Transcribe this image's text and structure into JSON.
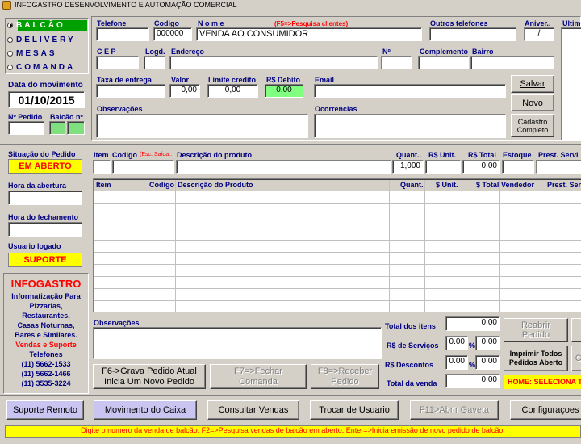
{
  "window": {
    "title": "INFOGASTRO DESENVOLVIMENTO E AUTOMAÇÃO COMERCIAL"
  },
  "modes": {
    "balcao": "BALCÃO",
    "delivery": "DELIVERY",
    "mesas": "MESAS",
    "comanda": "COMANDA",
    "selected": "BALCÃO"
  },
  "movimento": {
    "label": "Data do movimento",
    "date": "01/10/2015"
  },
  "pedido": {
    "label": "Nº Pedido",
    "balcao_label": "Balcão nº",
    "value": "",
    "balcao_value": ""
  },
  "customer": {
    "telefone_label": "Telefone",
    "telefone": "",
    "codigo_label": "Codigo",
    "codigo": "000000",
    "nome_label": "N o m e",
    "nome_hint": "(F5=>Pesquisa clientes)",
    "nome": "VENDA AO CONSUMIDOR",
    "outros_label": "Outros telefones",
    "outros": "",
    "aniver_label": "Aniver..",
    "aniver": "/",
    "ultimo_label": "Ultimo",
    "cep_label": "C E P",
    "cep": "",
    "logd_label": "Logd.",
    "logd": "",
    "endereco_label": "Endereço",
    "endereco": "",
    "numero_label": "Nº",
    "numero": "",
    "complemento_label": "Complemento",
    "complemento": "",
    "bairro_label": "Bairro",
    "bairro": "",
    "taxa_label": "Taxa de entrega",
    "taxa": "",
    "valor_label": "Valor",
    "valor": "0,00",
    "limite_label": "Limite credito",
    "limite": "0,00",
    "debito_label": "R$ Debito",
    "debito": "0,00",
    "email_label": "Email",
    "email": "",
    "obs_label": "Observações",
    "obs": "",
    "ocorrencias_label": "Ocorrencias",
    "ocorrencias": ""
  },
  "actions": {
    "salvar": "Salvar",
    "novo": "Novo",
    "cadastro_1": "Cadastro",
    "cadastro_2": "Completo"
  },
  "status": {
    "situacao_label": "Situação do Pedido",
    "situacao": "EM ABERTO",
    "abertura_label": "Hora da abertura",
    "abertura": "",
    "fechamento_label": "Hora do fechamento",
    "fechamento": "",
    "usuario_label": "Usuario logado",
    "usuario": "SUPORTE"
  },
  "company": {
    "name": "INFOGASTRO",
    "line1": "Informatização Para",
    "line2": "Pizzarias,",
    "line3": "Restaurantes,",
    "line4": "Casas Noturnas,",
    "line5": "Bares e Similares.",
    "line6": "Vendas e Suporte",
    "line7": "Telefones",
    "phone1": "(11) 5662-1533",
    "phone2": "(11) 5662-1466",
    "phone3": "(11) 3535-3224"
  },
  "entry": {
    "item_label": "Item",
    "codigo_label": "Codigo",
    "codigo_hint": "(Esc: Saída..",
    "descricao_label": "Descrição do produto",
    "quant_label": "Quant..",
    "unit_label": "R$ Unit.",
    "total_label": "R$ Total",
    "estoque_label": "Estoque",
    "prest_label": "Prest. Servi",
    "quant": "1,000",
    "unit": "",
    "total": "0,00"
  },
  "grid": {
    "columns": [
      "Item",
      "Codigo",
      "Descrição do Produto",
      "Quant.",
      "$ Unit.",
      "$ Total",
      "Vendedor",
      "Prest. Serv"
    ]
  },
  "bottom": {
    "obs_label": "Observações",
    "total_itens_label": "Total  dos itens",
    "total_itens": "0,00",
    "servicos_label": "R$ de Serviços",
    "servicos_pct": "0.00",
    "servicos": "0,00",
    "descontos_label": "R$   Descontos",
    "descontos_pct": "0.00",
    "descontos": "0,00",
    "total_venda_label": "Total da venda",
    "total_venda": "0,00",
    "pct_symbol": "%"
  },
  "buttons": {
    "f6_1": "F6->Grava Pedido Atual",
    "f6_2": "Inicia Um Novo Pedido",
    "f7_1": "F7=>Fechar",
    "f7_2": "Comanda",
    "f8_1": "F8=>Receber",
    "f8_2": "Pedido",
    "reabrir_1": "Reabrir",
    "reabrir_2": "Pedido",
    "imprimir_1": "Imprimir Todos",
    "imprimir_2": "Pedidos Aberto",
    "ci": "Ci",
    "home_msg": "HOME: SELECIONA TI",
    "suporte": "Suporte Remoto",
    "movimento": "Movimento do Caixa",
    "consultar": "Consultar Vendas",
    "trocar": "Trocar de Usuario",
    "f11": "F11>Abrir Gaveta",
    "config": "Configuraçoes"
  },
  "statusbar": {
    "message": "Digite o numero da venda de balcão.  F2=>Pesquisa vendas de balcão em aberto.  Enter=>Inicia emissão de novo pedido de balcão."
  },
  "colors": {
    "yellow": "#ffff00",
    "green": "#80ff80",
    "navy": "#000080",
    "red": "#ff0000",
    "purple": "#c9c4f0"
  }
}
